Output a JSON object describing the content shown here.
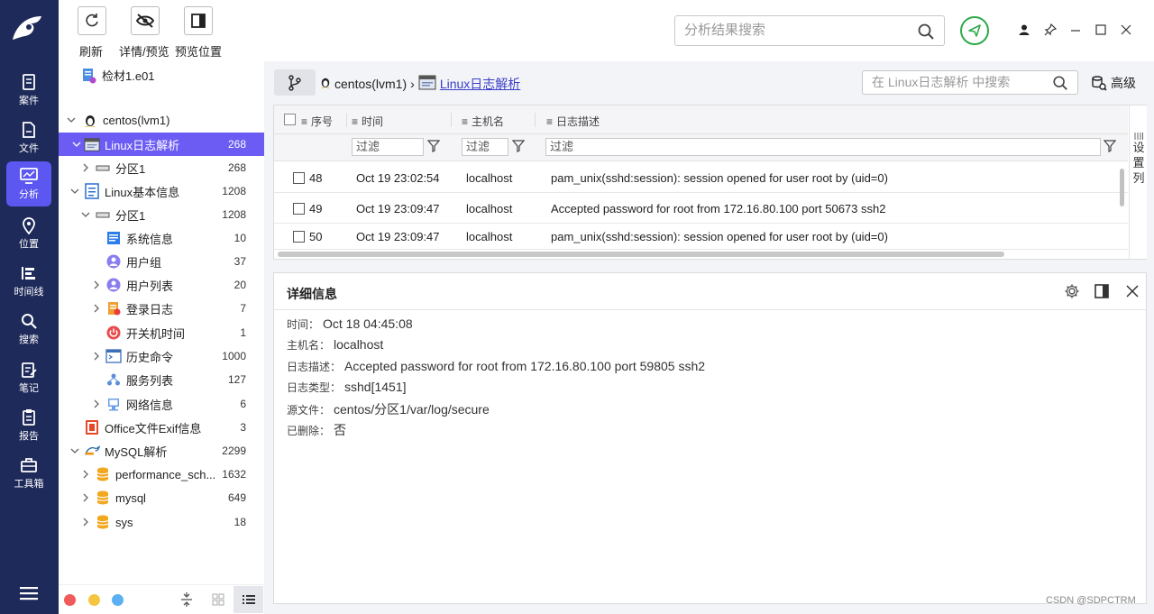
{
  "colors": {
    "rail_bg": "#1e2a5a",
    "accent": "#5b57f0",
    "selected_row": "#6c5cf3",
    "share_green": "#2eaa4a"
  },
  "rail": {
    "items": [
      {
        "label": "案件",
        "icon": "case-icon"
      },
      {
        "label": "文件",
        "icon": "file-icon"
      },
      {
        "label": "分析",
        "icon": "analysis-icon"
      },
      {
        "label": "位置",
        "icon": "location-icon"
      },
      {
        "label": "时间线",
        "icon": "timeline-icon"
      },
      {
        "label": "搜索",
        "icon": "search-icon"
      },
      {
        "label": "笔记",
        "icon": "notes-icon"
      },
      {
        "label": "报告",
        "icon": "report-icon"
      },
      {
        "label": "工具箱",
        "icon": "toolbox-icon"
      }
    ]
  },
  "toolbar": {
    "refresh": "刷新",
    "detail_preview": "详情/预览",
    "preview_position": "预览位置"
  },
  "case_name": "检材1.e01",
  "tree": {
    "rows": [
      {
        "label": "centos(lvm1)",
        "count": ""
      },
      {
        "label": "Linux日志解析",
        "count": "268"
      },
      {
        "label": "分区1",
        "count": "268"
      },
      {
        "label": "Linux基本信息",
        "count": "1208"
      },
      {
        "label": "分区1",
        "count": "1208"
      },
      {
        "label": "系统信息",
        "count": "10"
      },
      {
        "label": "用户组",
        "count": "37"
      },
      {
        "label": "用户列表",
        "count": "20"
      },
      {
        "label": "登录日志",
        "count": "7"
      },
      {
        "label": "开关机时间",
        "count": "1"
      },
      {
        "label": "历史命令",
        "count": "1000"
      },
      {
        "label": "服务列表",
        "count": "127"
      },
      {
        "label": "网络信息",
        "count": "6"
      },
      {
        "label": "Office文件Exif信息",
        "count": "3"
      },
      {
        "label": "MySQL解析",
        "count": "2299"
      },
      {
        "label": "performance_sch...",
        "count": "1632"
      },
      {
        "label": "mysql",
        "count": "649"
      },
      {
        "label": "sys",
        "count": "18"
      }
    ]
  },
  "search": {
    "main_placeholder": "分析结果搜索",
    "sub_placeholder": "在 Linux日志解析 中搜索"
  },
  "breadcrumb": {
    "root": "centos(lvm1)",
    "separator": "›",
    "current": "Linux日志解析"
  },
  "advanced_label": "高级",
  "grid": {
    "headers": {
      "index": "序号",
      "time": "时间",
      "host": "主机名",
      "desc": "日志描述"
    },
    "filter_label": "过滤",
    "column_settings": [
      "设",
      "置",
      "列"
    ],
    "rows": [
      {
        "index": "48",
        "time": "Oct 19 23:02:54",
        "host": "localhost",
        "desc": "pam_unix(sshd:session): session opened for user root by (uid=0)"
      },
      {
        "index": "49",
        "time": "Oct 19 23:09:47",
        "host": "localhost",
        "desc": "Accepted password for root from 172.16.80.100 port 50673 ssh2"
      },
      {
        "index": "50",
        "time": "Oct 19 23:09:47",
        "host": "localhost",
        "desc": "pam_unix(sshd:session): session opened for user root by (uid=0)"
      }
    ]
  },
  "detail": {
    "title": "详细信息",
    "fields": [
      {
        "key": "时间：",
        "value": "Oct 18 04:45:08"
      },
      {
        "key": "主机名：",
        "value": "localhost"
      },
      {
        "key": "日志描述：",
        "value": "Accepted password for root from 172.16.80.100 port 59805 ssh2"
      },
      {
        "key": "日志类型：",
        "value": "sshd[1451]"
      },
      {
        "key": "源文件：",
        "value": "centos/分区1/var/log/secure"
      },
      {
        "key": "已删除：",
        "value": "否"
      }
    ]
  },
  "watermark": "CSDN @SDPCTRM"
}
